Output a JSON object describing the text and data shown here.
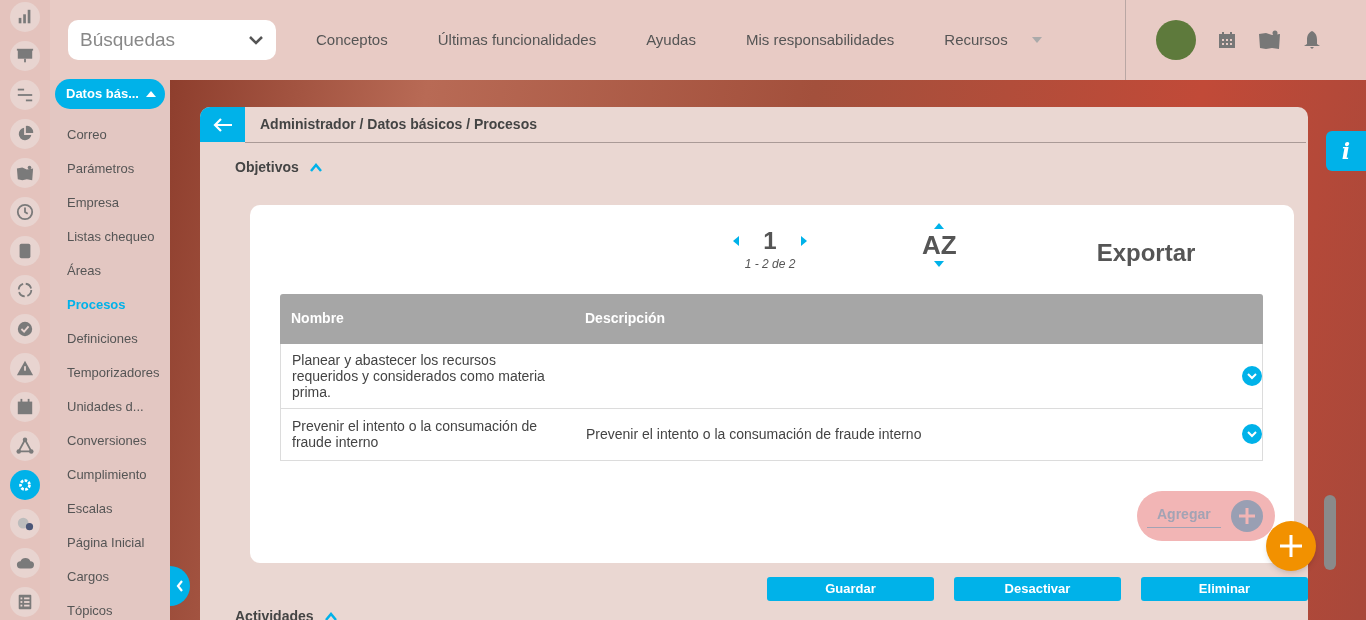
{
  "rail": [
    {
      "kind": "chart",
      "selected": false
    },
    {
      "kind": "presentation",
      "selected": false
    },
    {
      "kind": "gantt",
      "selected": false
    },
    {
      "kind": "pie",
      "selected": false
    },
    {
      "kind": "map",
      "selected": false
    },
    {
      "kind": "clock",
      "selected": false
    },
    {
      "kind": "list",
      "selected": false
    },
    {
      "kind": "cycle",
      "selected": false
    },
    {
      "kind": "check",
      "selected": false
    },
    {
      "kind": "warning",
      "selected": false
    },
    {
      "kind": "calendar",
      "selected": false
    },
    {
      "kind": "nodes",
      "selected": false
    },
    {
      "kind": "gear",
      "selected": true
    },
    {
      "kind": "gears",
      "selected": false
    },
    {
      "kind": "cloud",
      "selected": false
    },
    {
      "kind": "checklist",
      "selected": false
    }
  ],
  "header": {
    "search": {
      "value": "Búsquedas"
    },
    "nav": [
      {
        "label": "Conceptos",
        "dropdown": false
      },
      {
        "label": "Últimas funcionalidades",
        "dropdown": false
      },
      {
        "label": "Ayudas",
        "dropdown": false
      },
      {
        "label": "Mis responsabilidades",
        "dropdown": false
      },
      {
        "label": "Recursos",
        "dropdown": true
      }
    ]
  },
  "submenu": {
    "title": "Datos bás...",
    "items": [
      {
        "label": "Correo",
        "selected": false
      },
      {
        "label": "Parámetros",
        "selected": false
      },
      {
        "label": "Empresa",
        "selected": false
      },
      {
        "label": "Listas chequeo",
        "selected": false
      },
      {
        "label": "Áreas",
        "selected": false
      },
      {
        "label": "Procesos",
        "selected": true
      },
      {
        "label": "Definiciones",
        "selected": false
      },
      {
        "label": "Temporizadores",
        "selected": false
      },
      {
        "label": "Unidades d...",
        "selected": false
      },
      {
        "label": "Conversiones",
        "selected": false
      },
      {
        "label": "Cumplimiento",
        "selected": false
      },
      {
        "label": "Escalas",
        "selected": false
      },
      {
        "label": "Página Inicial",
        "selected": false
      },
      {
        "label": "Cargos",
        "selected": false
      },
      {
        "label": "Tópicos",
        "selected": false
      }
    ]
  },
  "breadcrumb": "Administrador / Datos básicos / Procesos",
  "sections": [
    {
      "title": "Objetivos",
      "expanded": true
    },
    {
      "title": "Actividades",
      "expanded": true
    }
  ],
  "pagination": {
    "page": "1",
    "range": "1 - 2 de 2"
  },
  "sort": {
    "label": "AZ"
  },
  "export": "Exportar",
  "table": {
    "columns": [
      "Nombre",
      "Descripción"
    ],
    "rows": [
      [
        "Planear y abastecer los recursos requeridos y considerados como materia prima.",
        ""
      ],
      [
        "Prevenir el intento o la consumación de fraude interno",
        "Prevenir el intento o la consumación de fraude interno"
      ]
    ]
  },
  "add_button": "Agregar",
  "actions": [
    "Guardar",
    "Desactivar",
    "Eliminar"
  ],
  "info_tab": "i"
}
